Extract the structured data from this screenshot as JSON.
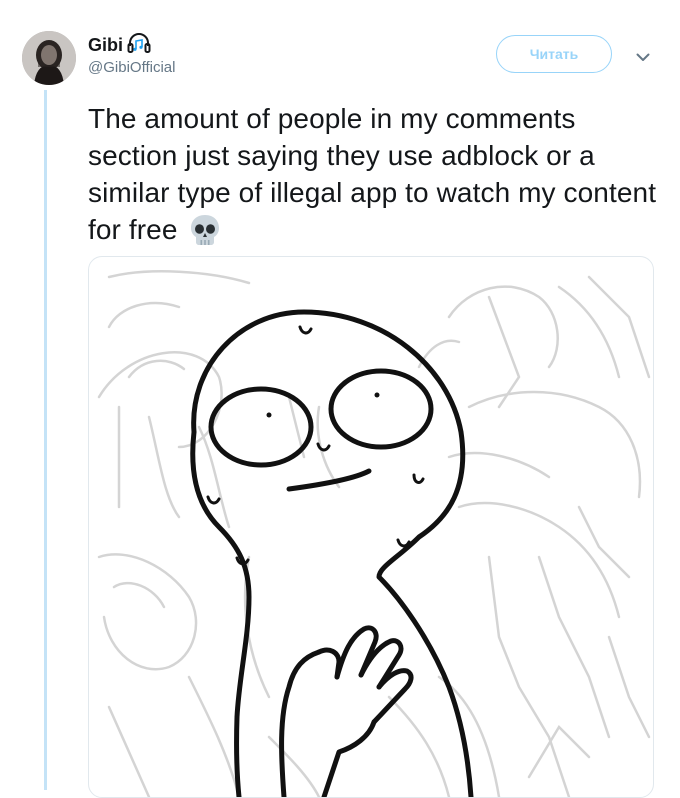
{
  "tweet": {
    "display_name": "Gibi",
    "handle": "@GibiOfficial",
    "follow_label": "Читать",
    "text": "The amount of people in my comments section just saying they use adblock or a similar type of illegal app to watch my content for free",
    "emoji": "skull-emoji"
  },
  "icons": {
    "verified_badge": "headphones-music-icon",
    "menu": "chevron-down-icon"
  },
  "colors": {
    "accent": "#1da1f2",
    "thread_line": "#c4e3f7",
    "secondary_text": "#657786"
  }
}
